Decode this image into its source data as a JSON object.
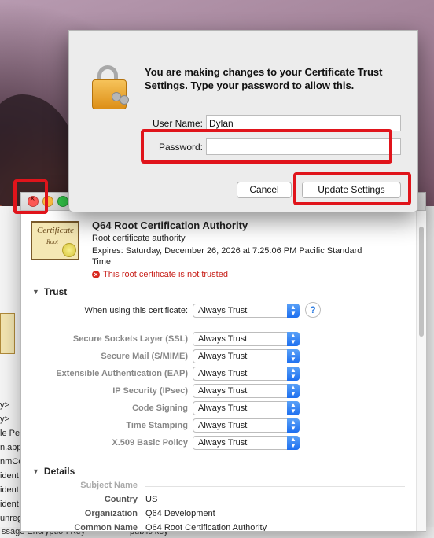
{
  "dialog": {
    "message": "You are making changes to your Certificate Trust Settings. Type your password to allow this.",
    "username_label": "User Name:",
    "username_value": "Dylan",
    "password_label": "Password:",
    "password_value": "",
    "cancel_label": "Cancel",
    "update_label": "Update Settings"
  },
  "certificate": {
    "icon_title": "Certificate",
    "icon_subtitle": "Root",
    "name": "Q64 Root Certification Authority",
    "type": "Root certificate authority",
    "expires_line1": "Expires: Saturday, December 26, 2026 at 7:25:06 PM Pacific Standard",
    "expires_line2": "Time",
    "status": "This root certificate is not trusted"
  },
  "trust": {
    "section_label": "Trust",
    "when_using_label": "When using this certificate:",
    "when_using_value": "Always Trust",
    "help_glyph": "?",
    "rows": [
      {
        "label": "Secure Sockets Layer (SSL)",
        "value": "Always Trust"
      },
      {
        "label": "Secure Mail (S/MIME)",
        "value": "Always Trust"
      },
      {
        "label": "Extensible Authentication (EAP)",
        "value": "Always Trust"
      },
      {
        "label": "IP Security (IPsec)",
        "value": "Always Trust"
      },
      {
        "label": "Code Signing",
        "value": "Always Trust"
      },
      {
        "label": "Time Stamping",
        "value": "Always Trust"
      },
      {
        "label": "X.509 Basic Policy",
        "value": "Always Trust"
      }
    ]
  },
  "details": {
    "section_label": "Details",
    "subject_name_label": "Subject Name",
    "rows": [
      {
        "label": "Country",
        "value": "US"
      },
      {
        "label": "Organization",
        "value": "Q64 Development"
      },
      {
        "label": "Common Name",
        "value": "Q64 Root Certification Authority"
      }
    ]
  },
  "background_window": {
    "rows": [
      "y>",
      "y>",
      "le Pe",
      "n.appl",
      "nmCe",
      "ident",
      "ident",
      "ident",
      "unreg"
    ],
    "bottom_left": "ssage Encryption Key",
    "bottom_right": "public key"
  },
  "colors": {
    "highlight": "#e0141b",
    "accent": "#1d6ff0",
    "error": "#c8201a"
  }
}
